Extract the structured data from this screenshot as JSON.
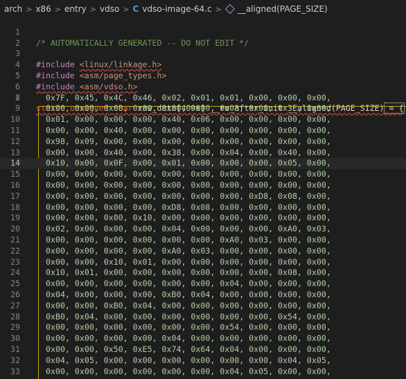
{
  "breadcrumb": {
    "items": [
      "arch",
      "x86",
      "entry",
      "vdso",
      "vdso-image-64.c",
      "__aligned(PAGE_SIZE)"
    ],
    "separator": ">"
  },
  "editor": {
    "comment": "/* AUTOMATICALLY GENERATED -- DO NOT EDIT */",
    "includes": [
      {
        "kw": "#include",
        "path": "<linux/linkage.h>"
      },
      {
        "kw": "#include",
        "path": "<asm/page_types.h>"
      },
      {
        "kw": "#include",
        "path": "<asm/vdso.h>"
      }
    ],
    "decl": {
      "static": "static",
      "unsigned": "unsigned",
      "char": "char",
      "name": "raw_data",
      "size": "4096",
      "attr1": "__ro_after_init",
      "attr2": "__aligned",
      "page_size": "PAGE_SIZE",
      "rest": " = {"
    },
    "data_rows": [
      "0x7F, 0x45, 0x4C, 0x46, 0x02, 0x01, 0x01, 0x00, 0x00, 0x00,",
      "0x00, 0x00, 0x00, 0x00, 0x00, 0x00, 0x03, 0x00, 0x3E, 0x00,",
      "0x01, 0x00, 0x00, 0x00, 0x40, 0x06, 0x00, 0x00, 0x00, 0x00,",
      "0x00, 0x00, 0x40, 0x00, 0x00, 0x00, 0x00, 0x00, 0x00, 0x00,",
      "0x98, 0x09, 0x00, 0x00, 0x00, 0x00, 0x00, 0x00, 0x00, 0x00,",
      "0x00, 0x00, 0x40, 0x00, 0x38, 0x00, 0x04, 0x00, 0x40, 0x00,",
      "0x10, 0x00, 0x0F, 0x00, 0x01, 0x00, 0x00, 0x00, 0x05, 0x00,",
      "0x00, 0x00, 0x00, 0x00, 0x00, 0x00, 0x00, 0x00, 0x00, 0x00,",
      "0x00, 0x00, 0x00, 0x00, 0x00, 0x00, 0x00, 0x00, 0x00, 0x00,",
      "0x00, 0x00, 0x00, 0x00, 0x00, 0x00, 0x00, 0xD8, 0x08, 0x00,",
      "0x00, 0x00, 0x00, 0x00, 0xD8, 0x08, 0x00, 0x00, 0x00, 0x00,",
      "0x00, 0x00, 0x00, 0x10, 0x00, 0x00, 0x00, 0x00, 0x00, 0x00,",
      "0x02, 0x00, 0x00, 0x00, 0x04, 0x00, 0x00, 0x00, 0xA0, 0x03,",
      "0x00, 0x00, 0x00, 0x00, 0x00, 0x00, 0xA0, 0x03, 0x00, 0x00,",
      "0x00, 0x00, 0x00, 0x00, 0xA0, 0x03, 0x00, 0x00, 0x00, 0x00,",
      "0x00, 0x00, 0x10, 0x01, 0x00, 0x00, 0x00, 0x00, 0x00, 0x00,",
      "0x10, 0x01, 0x00, 0x00, 0x00, 0x00, 0x00, 0x00, 0x08, 0x00,",
      "0x00, 0x00, 0x00, 0x00, 0x00, 0x00, 0x04, 0x00, 0x00, 0x00,",
      "0x04, 0x00, 0x00, 0x00, 0xB0, 0x04, 0x00, 0x00, 0x00, 0x00,",
      "0x00, 0x00, 0xB0, 0x04, 0x00, 0x00, 0x00, 0x00, 0x00, 0x00,",
      "0xB0, 0x04, 0x00, 0x00, 0x00, 0x00, 0x00, 0x00, 0x54, 0x00,",
      "0x00, 0x00, 0x00, 0x00, 0x00, 0x00, 0x54, 0x00, 0x00, 0x00,",
      "0x00, 0x00, 0x00, 0x00, 0x04, 0x00, 0x00, 0x00, 0x00, 0x00,",
      "0x00, 0x00, 0x50, 0xE5, 0x74, 0x64, 0x04, 0x00, 0x00, 0x00,",
      "0x04, 0x05, 0x00, 0x00, 0x00, 0x00, 0x00, 0x00, 0x04, 0x05,",
      "0x00, 0x00, 0x00, 0x00, 0x00, 0x00, 0x04, 0x05, 0x00, 0x00,"
    ],
    "line_numbers": [
      "1",
      "2",
      "3",
      "4",
      "5",
      "6",
      "7",
      "8",
      "9",
      "10",
      "11",
      "12",
      "13",
      "14",
      "15",
      "16",
      "17",
      "18",
      "19",
      "20",
      "21",
      "22",
      "23",
      "24",
      "25",
      "26",
      "27",
      "28",
      "29",
      "30",
      "31",
      "32",
      "33"
    ],
    "current_line": 14
  },
  "colors": {
    "background": "#1e1e1e",
    "comment": "#6a9955",
    "keyword": "#c586c0",
    "string": "#ce9178",
    "type": "#569cd6",
    "number": "#b5cea8"
  }
}
